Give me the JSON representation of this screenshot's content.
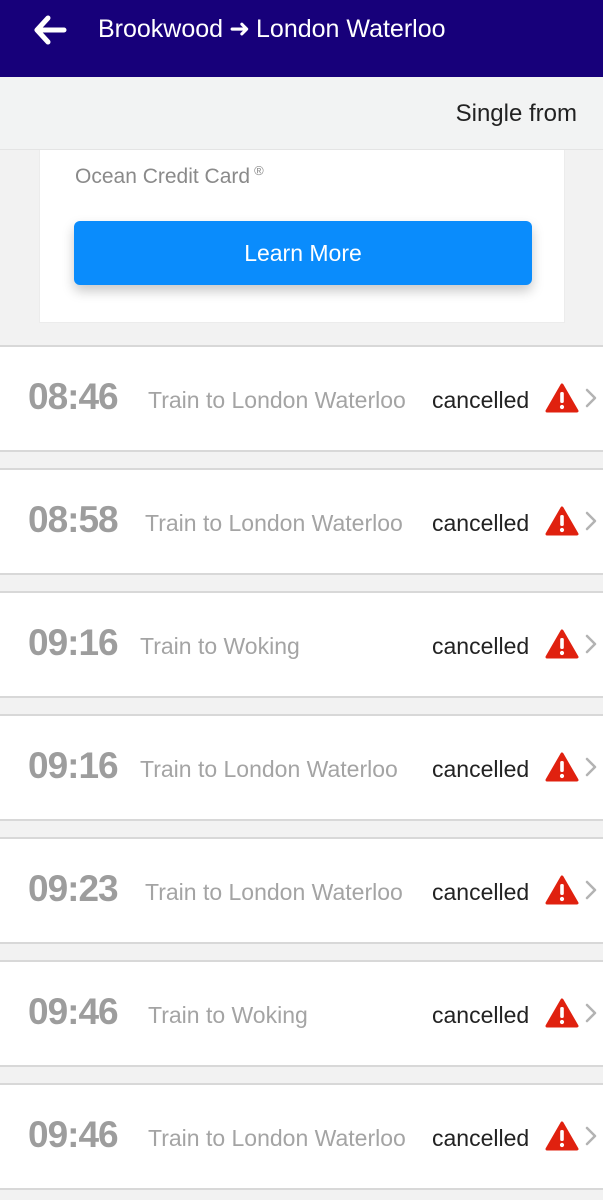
{
  "header": {
    "origin": "Brookwood",
    "arrow": "➜",
    "destination": "London Waterloo",
    "background_color": "#17007a"
  },
  "subheader": {
    "fare_label": "Single from"
  },
  "ad": {
    "title": "Ocean Credit Card",
    "registered_mark": "®",
    "button_label": "Learn More",
    "button_color": "#0a8cfc"
  },
  "departures": [
    {
      "time": "08:46",
      "destination": "Train to London Waterloo",
      "status": "cancelled"
    },
    {
      "time": "08:58",
      "destination": "Train to London Waterloo",
      "status": "cancelled"
    },
    {
      "time": "09:16",
      "destination": "Train to Woking",
      "status": "cancelled"
    },
    {
      "time": "09:16",
      "destination": "Train to London Waterloo",
      "status": "cancelled"
    },
    {
      "time": "09:23",
      "destination": "Train to London Waterloo",
      "status": "cancelled"
    },
    {
      "time": "09:46",
      "destination": "Train to Woking",
      "status": "cancelled"
    },
    {
      "time": "09:46",
      "destination": "Train to London Waterloo",
      "status": "cancelled"
    }
  ],
  "icons": {
    "back": "back-arrow-icon",
    "warning": "warning-triangle-icon",
    "chevron": "chevron-right-icon"
  },
  "colors": {
    "warning": "#e0210f"
  }
}
